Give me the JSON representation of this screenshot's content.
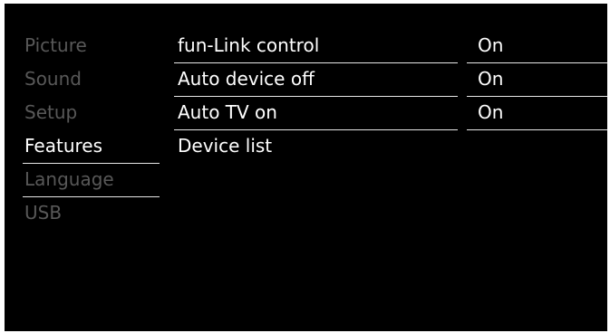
{
  "menu": {
    "items": [
      {
        "label": "Picture",
        "state": "dim"
      },
      {
        "label": "Sound",
        "state": "dim"
      },
      {
        "label": "Setup",
        "state": "dim"
      },
      {
        "label": "Features",
        "state": "selected"
      },
      {
        "label": "Language",
        "state": "dim"
      },
      {
        "label": "USB",
        "state": "dim"
      }
    ]
  },
  "submenu": {
    "items": [
      {
        "label": "fun-Link control",
        "value": "On"
      },
      {
        "label": "Auto device off",
        "value": "On"
      },
      {
        "label": "Auto TV on",
        "value": "On"
      },
      {
        "label": "Device list",
        "value": ""
      }
    ]
  },
  "colors": {
    "background": "#000000",
    "text": "#ffffff",
    "dim_text": "#585858",
    "divider": "#e8e8e8"
  }
}
